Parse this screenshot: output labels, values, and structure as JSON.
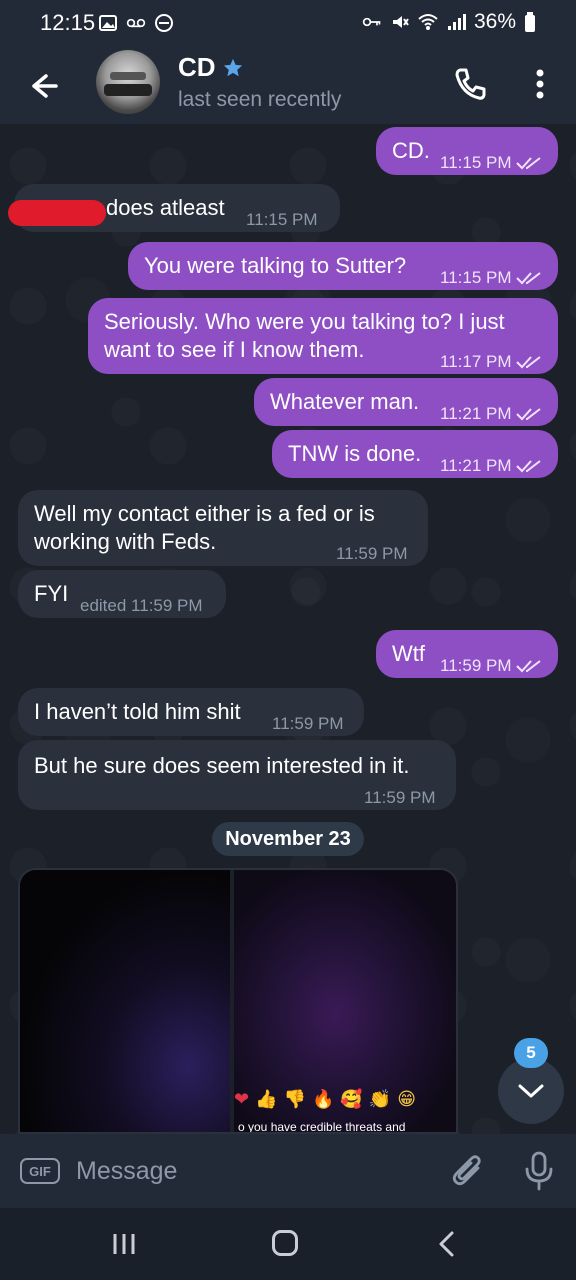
{
  "status_bar": {
    "time": "12:15",
    "battery": "36%"
  },
  "header": {
    "name": "CD",
    "status": "last seen recently"
  },
  "messages": [
    {
      "dir": "out",
      "text": "CD.",
      "time": "11:15 PM"
    },
    {
      "dir": "in",
      "text": "does atleast",
      "time": "11:15 PM",
      "redacted_prefix": true
    },
    {
      "dir": "out",
      "text": "You were talking to Sutter?",
      "time": "11:15 PM"
    },
    {
      "dir": "out",
      "text_line1": "Seriously. Who were you talking to? I just",
      "text_line2": "want to see if I know them.",
      "time": "11:17 PM"
    },
    {
      "dir": "out",
      "text": "Whatever man.",
      "time": "11:21 PM"
    },
    {
      "dir": "out",
      "text": "TNW is done.",
      "time": "11:21 PM"
    },
    {
      "dir": "in",
      "text_line1": "Well my contact either is a fed or is",
      "text_line2": "working with Feds.",
      "time": "11:59 PM"
    },
    {
      "dir": "in",
      "text": "FYI",
      "time": "edited 11:59 PM"
    },
    {
      "dir": "out",
      "text": "Wtf",
      "time": "11:59 PM"
    },
    {
      "dir": "in",
      "text": "I haven’t told him shit",
      "time": "11:59 PM"
    },
    {
      "dir": "in",
      "text": "But he sure does seem interested in it.",
      "time": "11:59 PM"
    }
  ],
  "date_separator": "November 23",
  "media": {
    "caption": "o you have credible threats and",
    "reactions": [
      "❤",
      "👍",
      "👎",
      "🔥",
      "🥰",
      "👏",
      "😁"
    ]
  },
  "scroll_down": {
    "unread_count": "5"
  },
  "input": {
    "placeholder": "Message",
    "gif_label": "GIF"
  },
  "colors": {
    "outgoing_bubble": "#8e4fc4",
    "incoming_bubble": "#2a313c",
    "background": "#1b2029",
    "header": "#232a37",
    "accent": "#4aa2e6"
  }
}
